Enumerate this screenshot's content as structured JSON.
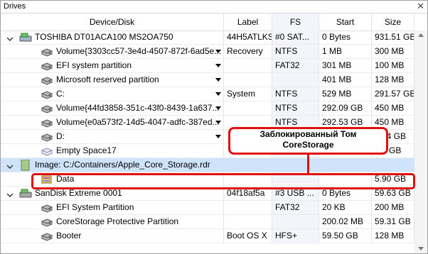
{
  "window": {
    "title": "Drives",
    "close_glyph": "✕"
  },
  "columns": [
    "Device/Disk",
    "Label",
    "FS",
    "Start",
    "Size"
  ],
  "rows": [
    {
      "indent": 0,
      "chevron": "down",
      "icon": "usb-drive",
      "name": "TOSHIBA DT01ACA100 MS2OA750",
      "label": "44H5ATLKS",
      "fs": "#0 SAT...",
      "start": "0 Bytes",
      "size": "931.51 GB",
      "dropdown": false
    },
    {
      "indent": 1,
      "chevron": "",
      "icon": "partition",
      "name": "Volume{3303cc57-3e4d-4507-872f-6ad5e...",
      "label": "Recovery",
      "fs": "NTFS",
      "start": "1 MB",
      "size": "300 MB",
      "dropdown": true
    },
    {
      "indent": 1,
      "chevron": "",
      "icon": "partition",
      "name": "EFI system partition",
      "label": "",
      "fs": "FAT32",
      "start": "301 MB",
      "size": "100 MB",
      "dropdown": true
    },
    {
      "indent": 1,
      "chevron": "",
      "icon": "partition",
      "name": "Microsoft reserved partition",
      "label": "",
      "fs": "",
      "start": "401 MB",
      "size": "128 MB",
      "dropdown": true
    },
    {
      "indent": 1,
      "chevron": "",
      "icon": "partition",
      "name": "C:",
      "label": "System",
      "fs": "NTFS",
      "start": "529 MB",
      "size": "291.57 GB",
      "dropdown": true
    },
    {
      "indent": 1,
      "chevron": "",
      "icon": "partition",
      "name": "Volume{44fd3858-351c-43f0-8439-1a637...",
      "label": "",
      "fs": "NTFS",
      "start": "292.09 GB",
      "size": "450 MB",
      "dropdown": true
    },
    {
      "indent": 1,
      "chevron": "",
      "icon": "partition",
      "name": "Volume{e0a573f2-14d5-4047-adfc-387ed...",
      "label": "",
      "fs": "NTFS",
      "start": "292.53 GB",
      "size": "450 MB",
      "dropdown": true
    },
    {
      "indent": 1,
      "chevron": "",
      "icon": "partition",
      "name": "D:",
      "label": "",
      "fs": "",
      "start": "",
      "size": "...54 GB",
      "dropdown": true
    },
    {
      "indent": 1,
      "chevron": "",
      "icon": "empty-space",
      "name": "Empty Space17",
      "label": "",
      "fs": "",
      "start": "",
      "size": "...8 GB",
      "dropdown": false
    },
    {
      "indent": 0,
      "chevron": "down",
      "icon": "image-file",
      "name": "Image: C:/Containers/Apple_Core_Storage.rdr",
      "label": "",
      "fs": "",
      "start": "",
      "size": "",
      "dropdown": false,
      "selected": true
    },
    {
      "indent": 1,
      "chevron": "",
      "icon": "volume-locked",
      "name": "Data",
      "label": "",
      "fs": "",
      "start": "",
      "size": "5.90 GB",
      "dropdown": false
    },
    {
      "indent": 0,
      "chevron": "down",
      "icon": "usb-drive-gray",
      "name": "SanDisk Extreme 0001",
      "label": "04f18af5a",
      "fs": "#3 USB ...",
      "start": "0 Bytes",
      "size": "59.63 GB",
      "dropdown": false
    },
    {
      "indent": 1,
      "chevron": "",
      "icon": "partition",
      "name": "EFI System Partition",
      "label": "",
      "fs": "FAT32",
      "start": "20 KB",
      "size": "200 MB",
      "dropdown": false
    },
    {
      "indent": 1,
      "chevron": "",
      "icon": "partition",
      "name": "CoreStorage Protective Partition",
      "label": "",
      "fs": "",
      "start": "200.02 MB",
      "size": "59.31 GB",
      "dropdown": false
    },
    {
      "indent": 1,
      "chevron": "",
      "icon": "partition",
      "name": "Booter",
      "label": "Boot OS X",
      "fs": "HFS+",
      "start": "59.50 GB",
      "size": "128 MB",
      "dropdown": false
    }
  ],
  "annotation": {
    "line1": "Заблокированный Том",
    "line2": "CoreStorage"
  },
  "colors": {
    "accent_red": "#e01010",
    "selection": "#cfe3fb",
    "fs_column": "#f2f6fb"
  }
}
